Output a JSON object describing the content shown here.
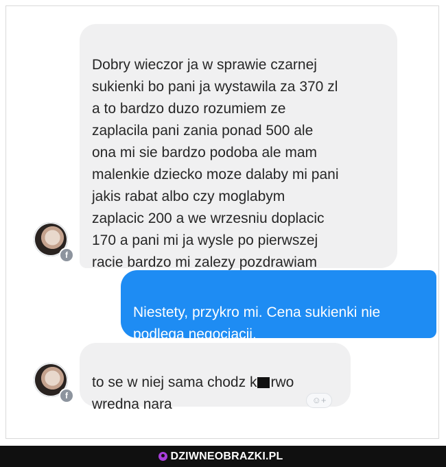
{
  "conversation": {
    "messages": [
      {
        "direction": "incoming",
        "text": "Dobry wieczor ja w sprawie czarnej\nsukienki bo pani ja wystawila za 370 zl\na to bardzo duzo rozumiem ze\nzaplacila pani zania ponad 500 ale\nona mi sie bardzo podoba ale mam\nmalenkie dziecko moze dalaby mi pani\njakis rabat albo czy moglabym\nzaplacic 200 a we wrzesniu doplacic\n170 a pani mi ja wysle po pierwszej\nracie bardzo mi zalezy pozdrawiam"
      },
      {
        "direction": "outgoing",
        "text": "Niestety, przykro mi. Cena sukienki nie\npodlega negocjacji."
      },
      {
        "direction": "incoming",
        "text_before": "to se w niej sama chodz k",
        "text_after": "rwo\nwredna nara"
      }
    ],
    "icons": {
      "avatar": "profile-avatar",
      "badge": "facebook-badge-icon",
      "reaction": "emoji-reaction-icon"
    },
    "colors": {
      "incoming_bubble": "#f0f0f1",
      "outgoing_bubble": "#1e8cf3",
      "footer": "#101010",
      "logo_accent": "#a83edb"
    }
  },
  "footer": {
    "logo_text": "DZIWNEOBRAZKI.PL"
  }
}
